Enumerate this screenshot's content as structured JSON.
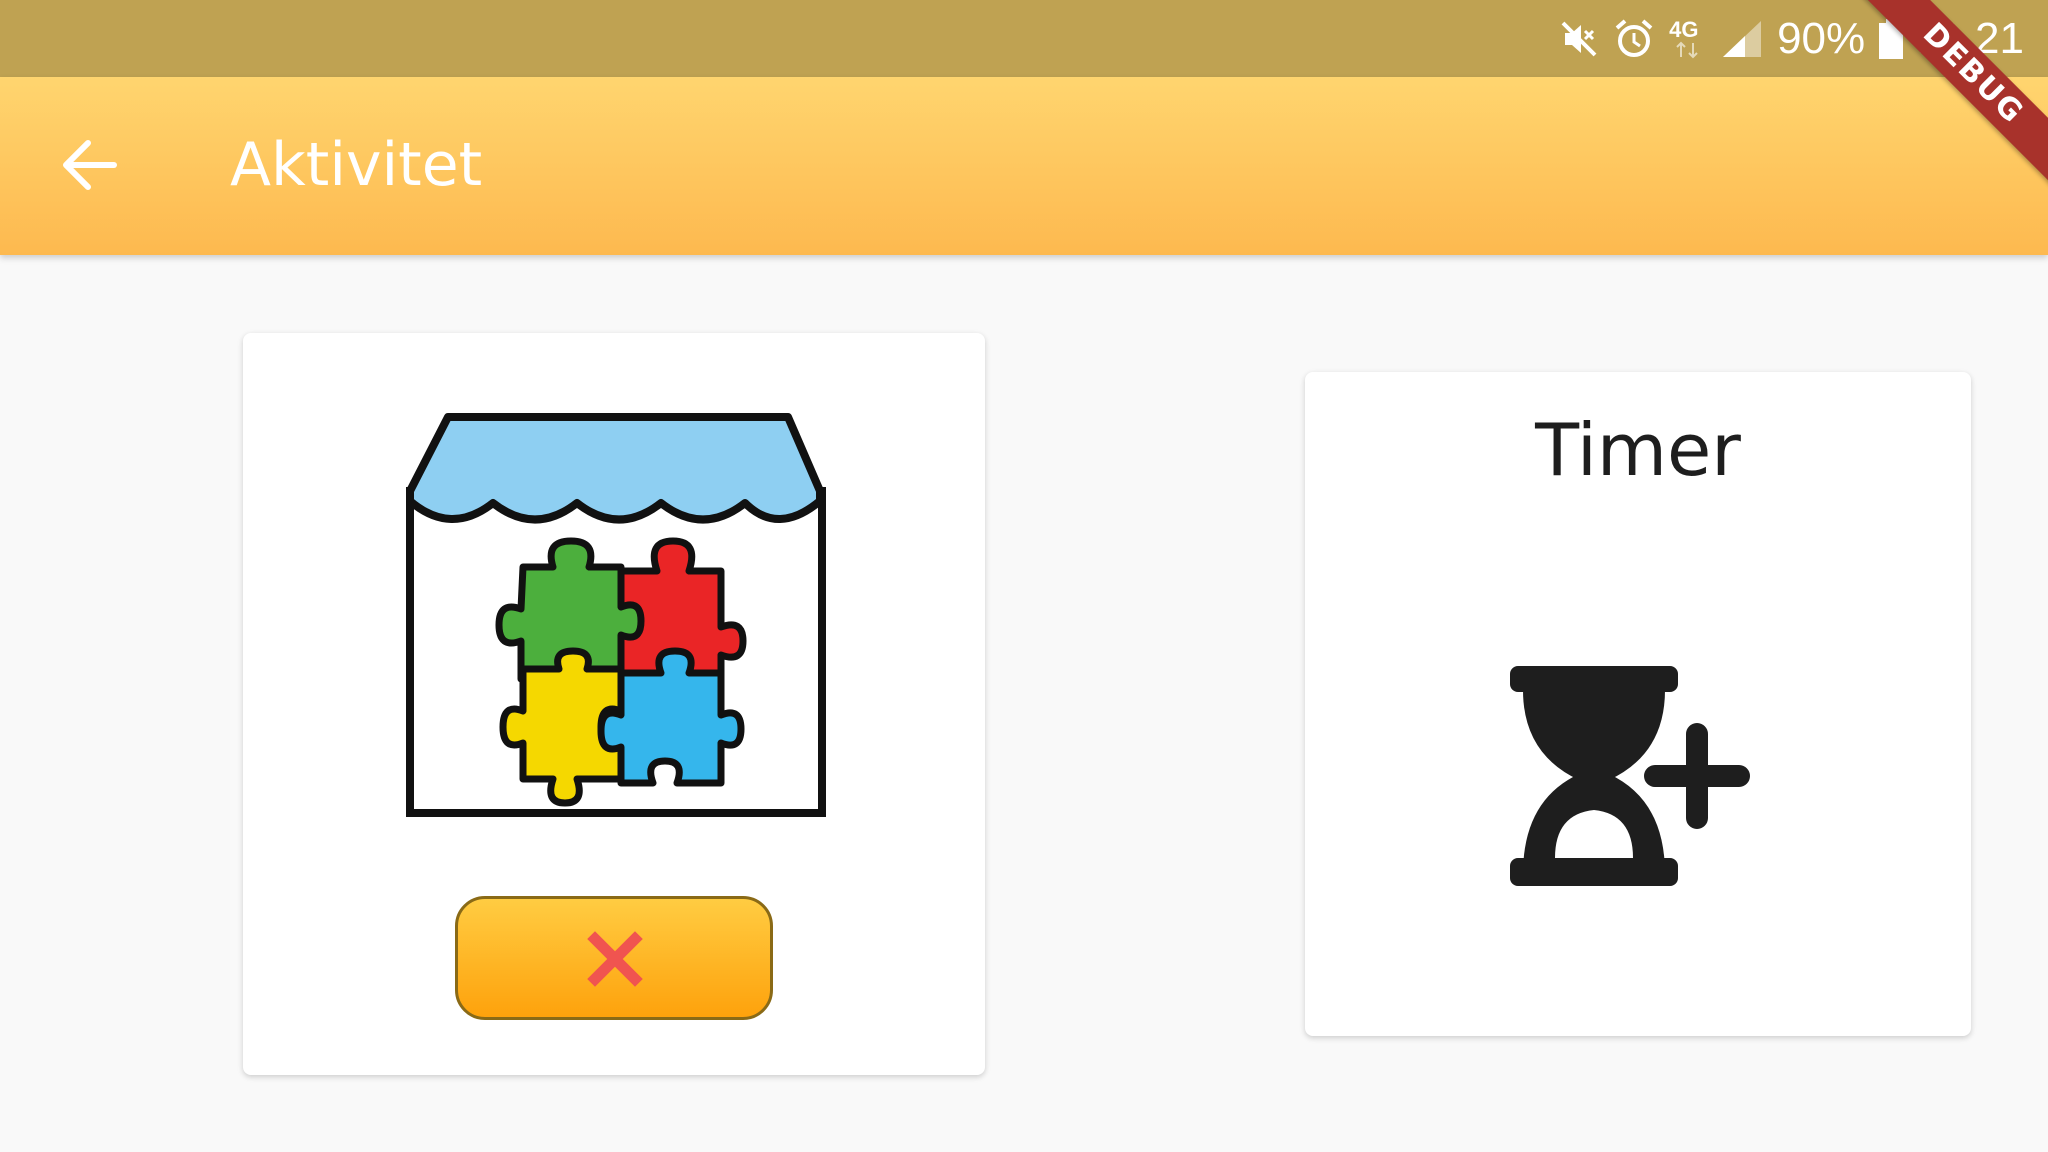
{
  "status_bar": {
    "network": "4G",
    "battery": "90%",
    "time": "11.21",
    "icons": [
      "mute-icon",
      "alarm-icon",
      "network-4g-icon",
      "signal-icon",
      "battery-icon"
    ]
  },
  "debug_banner": "DEBUG",
  "app_bar": {
    "title": "Aktivitet",
    "back_icon": "arrow-back-icon"
  },
  "activity_card": {
    "pictogram": "puzzle-shop-pictogram",
    "cancel_icon": "close-icon"
  },
  "timer_card": {
    "title": "Timer",
    "icon": "hourglass-add-icon"
  },
  "colors": {
    "status_bar": "#bfa252",
    "app_bar_top": "#ffd56f",
    "app_bar_bottom": "#fdb94f",
    "button_top": "#ffcc42",
    "button_bottom": "#fea20c",
    "cancel_x": "#f05450",
    "debug_ribbon": "#a8322b"
  }
}
